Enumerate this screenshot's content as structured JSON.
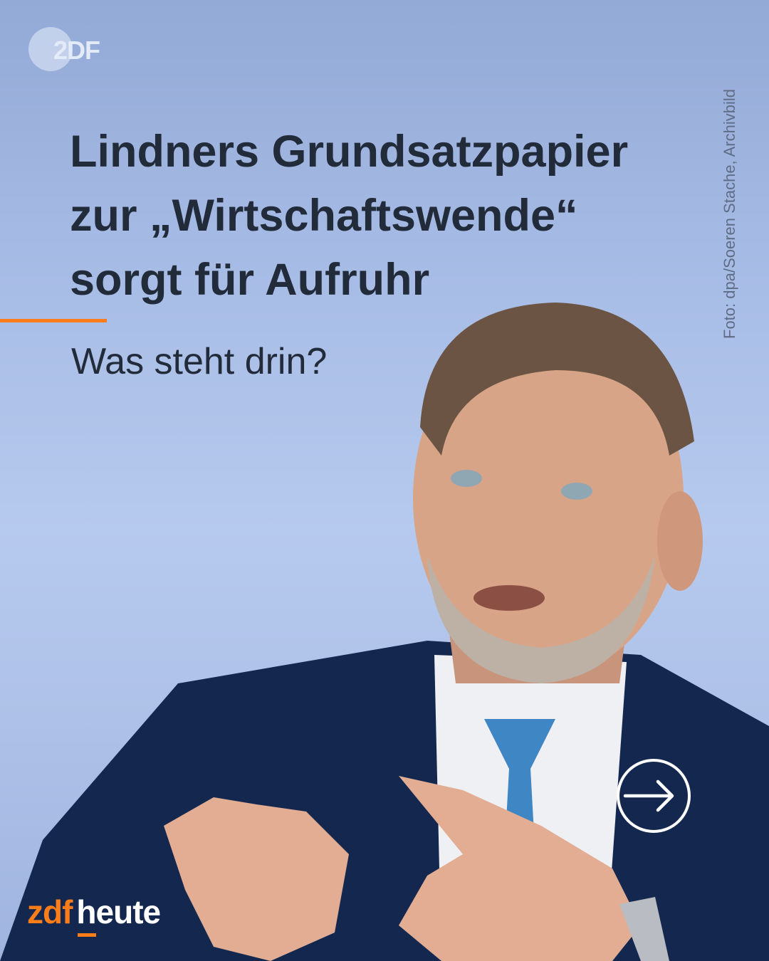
{
  "logo_top": {
    "text": "2DF"
  },
  "headline": {
    "line1": "Lindners Grundsatzpapier",
    "line2": "zur „Wirtschaftswende“",
    "line3": "sorgt für Aufruhr"
  },
  "subheadline": "Was steht drin?",
  "photo_credit": "Foto: dpa/Soeren Stache, Archivbild",
  "brand": {
    "part1": "zdf",
    "part2": "heute"
  },
  "colors": {
    "accent": "#fa7d19",
    "text": "#222b3a",
    "background": "#a8bde6"
  }
}
